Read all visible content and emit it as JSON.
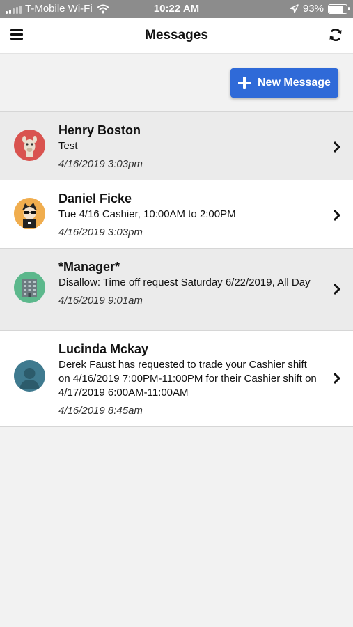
{
  "status_bar": {
    "carrier": "T-Mobile Wi-Fi",
    "time": "10:22 AM",
    "battery": "93%",
    "battery_level": 0.93
  },
  "header": {
    "title": "Messages",
    "menu_icon": "hamburger-menu-icon",
    "refresh_icon": "refresh-icon"
  },
  "toolbar": {
    "new_message_label": "New Message",
    "accent_color": "#2f6ad8"
  },
  "messages": [
    {
      "name": "Henry Boston",
      "preview": "Test",
      "date": "4/16/2019 3:03pm",
      "avatar": "llama-avatar",
      "avatar_color": "#d9534f"
    },
    {
      "name": "Daniel Ficke",
      "preview": "Tue 4/16 Cashier, 10:00AM to 2:00PM",
      "date": "4/16/2019 3:03pm",
      "avatar": "sunglasses-person-avatar",
      "avatar_color": "#f0ad4e"
    },
    {
      "name": "*Manager*",
      "preview": "Disallow: Time off request Saturday 6/22/2019, All Day",
      "date": "4/16/2019 9:01am",
      "avatar": "building-avatar",
      "avatar_color": "#5cb88c"
    },
    {
      "name": "Lucinda Mckay",
      "preview": "Derek Faust has requested to trade your Cashier shift on 4/16/2019 7:00PM-11:00PM for their Cashier shift on 4/17/2019 6:00AM-11:00AM",
      "date": "4/16/2019 8:45am",
      "avatar": "person-silhouette-avatar",
      "avatar_color": "#3f7a8f"
    }
  ]
}
